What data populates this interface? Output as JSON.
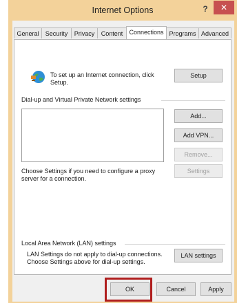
{
  "window": {
    "title": "Internet Options",
    "help_label": "?",
    "close_label": "✕"
  },
  "tabs": [
    "General",
    "Security",
    "Privacy",
    "Content",
    "Connections",
    "Programs",
    "Advanced"
  ],
  "active_tab": "Connections",
  "setup": {
    "text": "To set up an Internet connection, click Setup.",
    "button": "Setup"
  },
  "dialup": {
    "heading": "Dial-up and Virtual Private Network settings",
    "add_button": "Add...",
    "add_vpn_button": "Add VPN...",
    "remove_button": "Remove...",
    "proxy_text": "Choose Settings if you need to configure a proxy server for a connection.",
    "settings_button": "Settings"
  },
  "lan": {
    "heading": "Local Area Network (LAN) settings",
    "text": "LAN Settings do not apply to dial-up connections. Choose Settings above for dial-up settings.",
    "button": "LAN settings"
  },
  "footer": {
    "ok": "OK",
    "cancel": "Cancel",
    "apply": "Apply"
  },
  "colors": {
    "title_bar": "#f3d29a",
    "close": "#c75050",
    "highlight": "#b01e1e"
  },
  "icons": {
    "connection": "globe-network-icon"
  }
}
